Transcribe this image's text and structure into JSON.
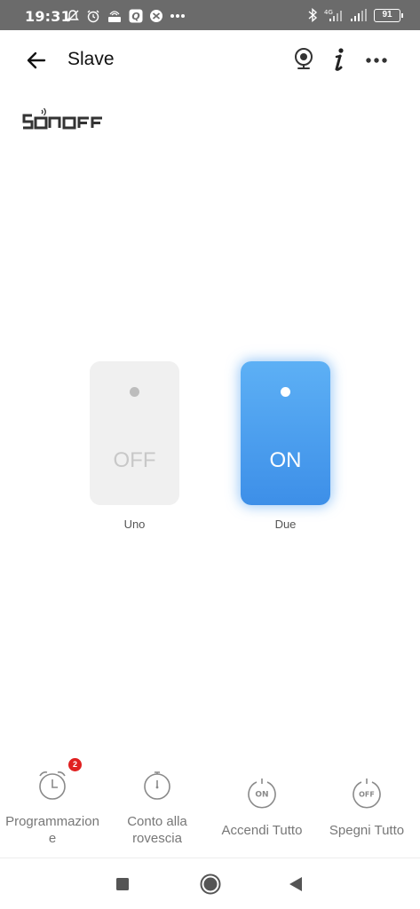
{
  "status_bar": {
    "time": "19:31",
    "network": "4G",
    "battery": "91"
  },
  "header": {
    "title": "Slave"
  },
  "logo": {
    "text": "SONOFF"
  },
  "switches": [
    {
      "name": "Uno",
      "state": "OFF",
      "on": false
    },
    {
      "name": "Due",
      "state": "ON",
      "on": true
    }
  ],
  "actions": {
    "schedule": {
      "label_line1": "Programmazion",
      "label_line2": "e",
      "badge": "2"
    },
    "countdown": {
      "label_line1": "Conto alla",
      "label_line2": "rovescia"
    },
    "all_on": {
      "label": "Accendi Tutto",
      "icon_text": "ON"
    },
    "all_off": {
      "label": "Spegni Tutto",
      "icon_text": "OFF"
    }
  },
  "colors": {
    "status_bar": "#6b6b6b",
    "switch_on": "#4a9cf0",
    "switch_off": "#f0f0f0",
    "badge": "#e02020"
  }
}
